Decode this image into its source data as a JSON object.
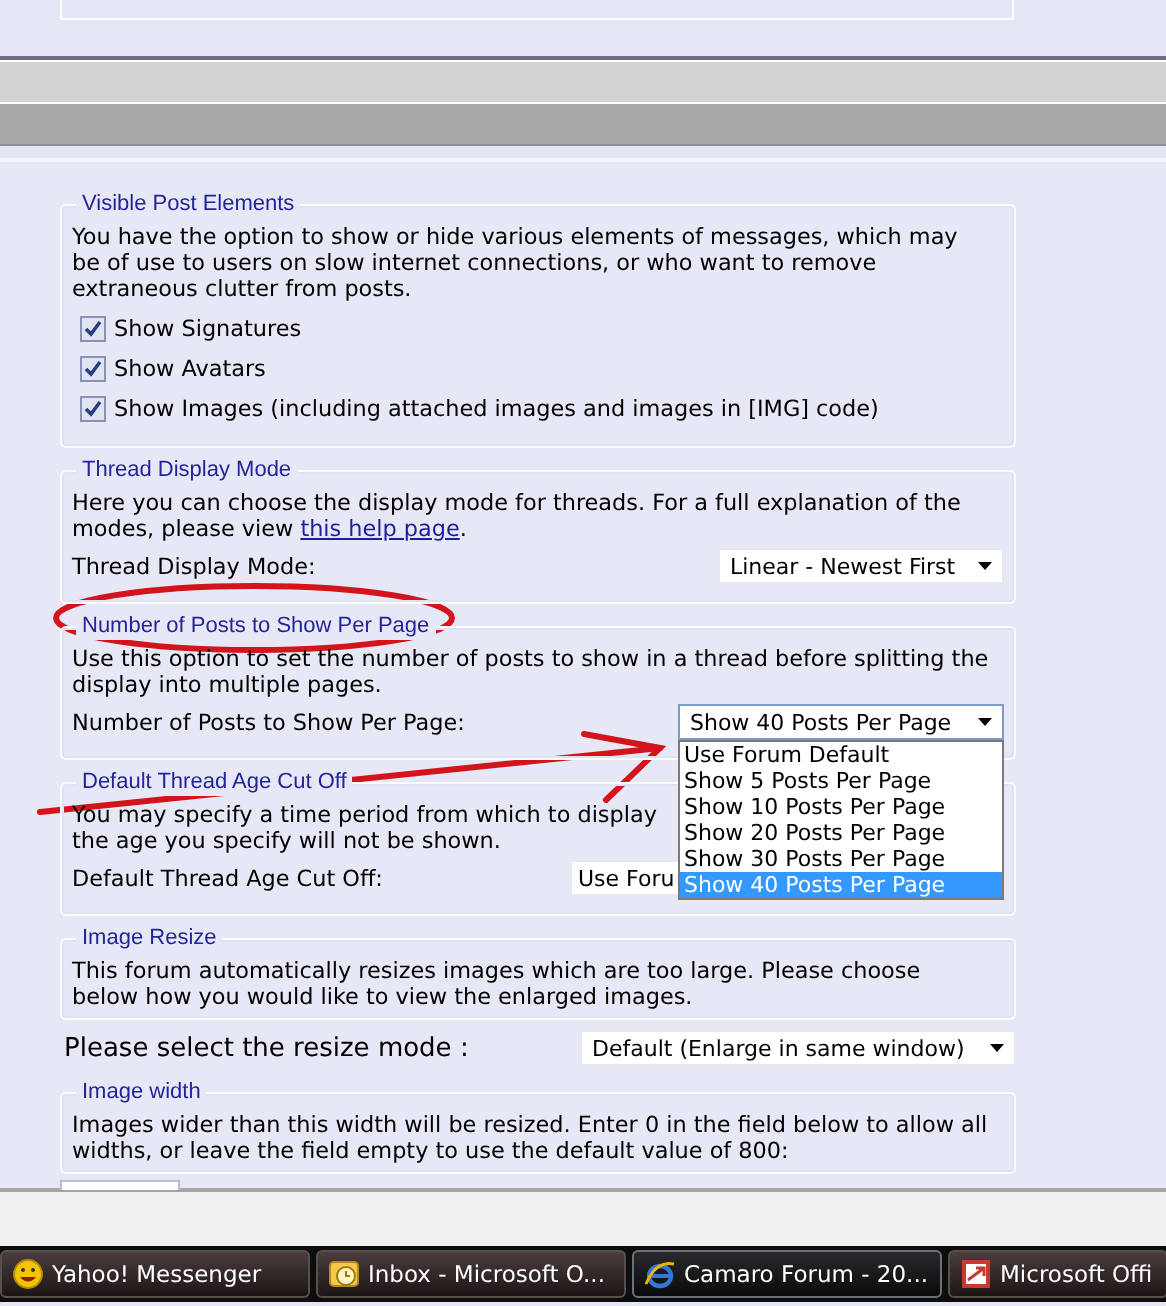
{
  "sections": [
    {
      "kind": "checkboxes",
      "legend": "Visible Post Elements",
      "description_lines": [
        "You have the option to show or hide various elements of messages, which may",
        "be of use to users on slow internet connections, or who want to remove",
        "extraneous clutter from posts."
      ],
      "options": [
        {
          "label": "Show Signatures",
          "checked": true
        },
        {
          "label": "Show Avatars",
          "checked": true
        },
        {
          "label": "Show Images (including attached images and images in [IMG] code)",
          "checked": true
        }
      ]
    },
    {
      "kind": "select",
      "legend": "Thread Display Mode",
      "description_lines": [
        "Here you can choose the display mode for threads. For a full explanation of the",
        "modes, please view "
      ],
      "link": "this help page",
      "description_end": ".",
      "field_label": "Thread Display Mode:",
      "value": "Linear - Newest First"
    },
    {
      "kind": "select",
      "legend": "Number of Posts to Show Per Page",
      "description_lines": [
        "Use this option to set the number of posts to show in a thread before splitting the",
        "display into multiple pages."
      ],
      "field_label": "Number of Posts to Show Per Page:",
      "value": "Show 40 Posts Per Page",
      "open_options": [
        {
          "label": "Use Forum Default",
          "selected": false
        },
        {
          "label": "Show 5 Posts Per Page",
          "selected": false
        },
        {
          "label": "Show 10 Posts Per Page",
          "selected": false
        },
        {
          "label": "Show 20 Posts Per Page",
          "selected": false
        },
        {
          "label": "Show 30 Posts Per Page",
          "selected": false
        },
        {
          "label": "Show 40 Posts Per Page",
          "selected": true
        }
      ]
    },
    {
      "kind": "select",
      "legend": "Default Thread Age Cut Off",
      "description_lines": [
        "You may specify a time period from which to display",
        "the age you specify will not be shown."
      ],
      "field_label": "Default Thread Age Cut Off:",
      "value": "Use Foru"
    },
    {
      "kind": "notice",
      "legend": "Image Resize",
      "description_lines": [
        "This forum automatically resizes images which are too large. Please choose",
        "below how you would like to view the enlarged images."
      ]
    },
    {
      "kind": "row",
      "field_label": "Please select the resize mode :",
      "value": "Default (Enlarge in same window)"
    },
    {
      "kind": "notice",
      "legend": "Image width",
      "description_lines": [
        "Images wider than this width will be resized. Enter 0 in the field below to allow all",
        "widths, or leave the field empty to use the default value of 800:"
      ]
    }
  ],
  "taskbar": [
    {
      "label": "Yahoo! Messenger",
      "selected": false
    },
    {
      "label": "Inbox - Microsoft O...",
      "selected": false
    },
    {
      "label": "Camaro Forum - 20...",
      "selected": true
    },
    {
      "label": "Microsoft Offi",
      "selected": false
    }
  ]
}
